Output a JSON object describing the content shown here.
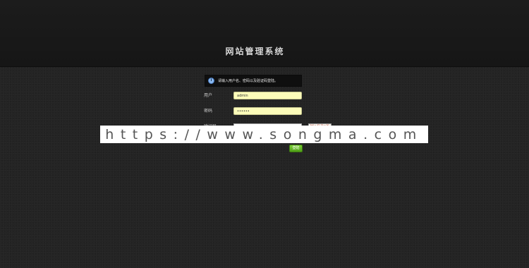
{
  "header": {
    "title": "网站管理系统"
  },
  "notice": {
    "icon": "info-icon",
    "text": "请输入用户名、密码以及验证码登陆。"
  },
  "form": {
    "username_label": "用户",
    "username_value": "admin",
    "password_label": "密码",
    "password_value": "••••••",
    "captcha_label": "验证码",
    "captcha_value": "",
    "captcha_image_text": "MaEZvX",
    "submit_label": "登陆"
  },
  "watermark": {
    "text": "https://www.songma.com"
  },
  "colors": {
    "background": "#242424",
    "header_band": "#1a1a1a",
    "input_fill": "#fcfcba",
    "button_green": "#5fb020"
  }
}
